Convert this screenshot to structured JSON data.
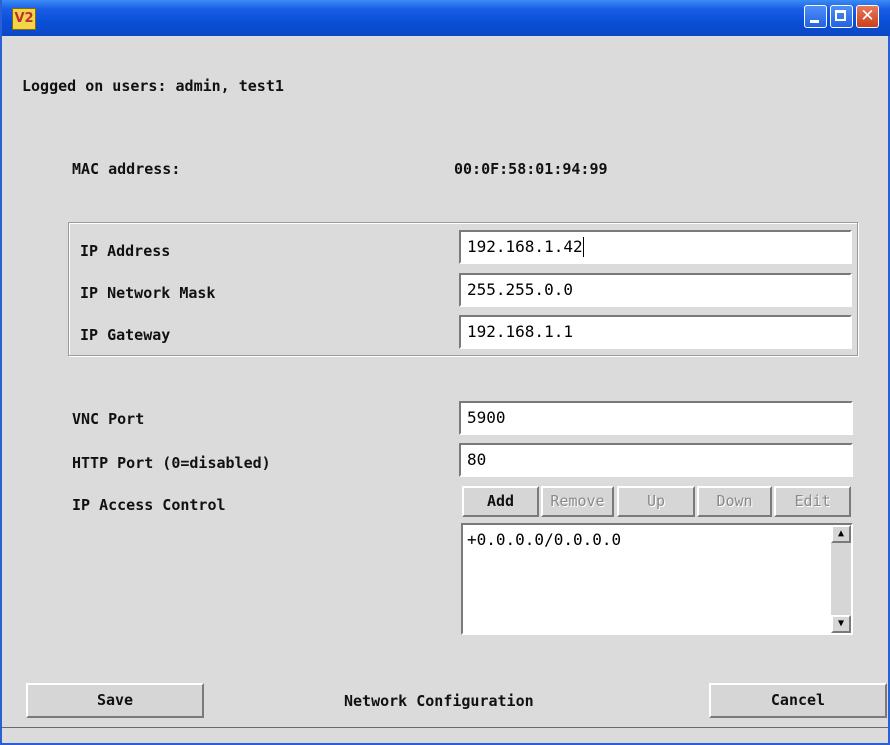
{
  "window": {
    "app_logo": "V2",
    "close_glyph": "✕"
  },
  "header": {
    "logged_on_users": "Logged on users: admin, test1"
  },
  "mac": {
    "label": "MAC address:",
    "value": "00:0F:58:01:94:99"
  },
  "ip": {
    "address_label": "IP Address",
    "address_value": "192.168.1.42",
    "mask_label": "IP Network Mask",
    "mask_value": "255.255.0.0",
    "gateway_label": "IP Gateway",
    "gateway_value": "192.168.1.1"
  },
  "ports": {
    "vnc_label": "VNC Port",
    "vnc_value": "5900",
    "http_label": "HTTP Port (0=disabled)",
    "http_value": "80"
  },
  "access_control": {
    "label": "IP Access Control",
    "add_label": "Add",
    "remove_label": "Remove",
    "up_label": "Up",
    "down_label": "Down",
    "edit_label": "Edit",
    "items": [
      "+0.0.0.0/0.0.0.0"
    ]
  },
  "footer": {
    "save_label": "Save",
    "title": "Network Configuration",
    "cancel_label": "Cancel"
  },
  "icons": {
    "scroll_up": "▲",
    "scroll_down": "▼"
  },
  "colors": {
    "titlebar": "#0a4fd8",
    "close_button": "#c8401e",
    "dialog_background": "#dbdbdb"
  }
}
